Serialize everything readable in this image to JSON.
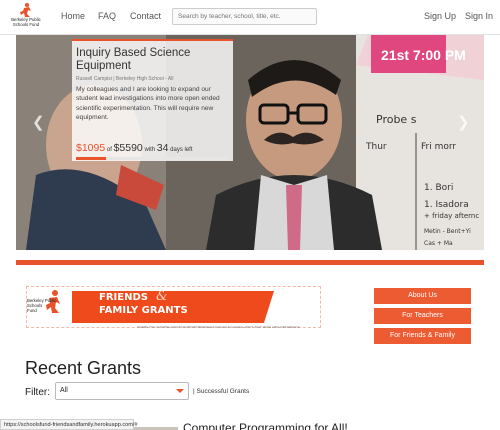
{
  "brand": {
    "line1": "Berkeley Public",
    "line2": "Schools Fund"
  },
  "nav": {
    "home": "Home",
    "faq": "FAQ",
    "contact": "Contact",
    "search_placeholder": "Search by teacher, school, title, etc.",
    "signup": "Sign Up",
    "signin": "Sign In"
  },
  "hero": {
    "title": "Inquiry Based Science Equipment",
    "school": "Russell Campisi | Berkeley High School - All",
    "description": "My colleagues and I are looking to expand our student lead investigations into more open ended scientific experimentation. This will require new equipment.",
    "raised": "$1095",
    "of": "of",
    "goal": "$5590",
    "with": "with",
    "days": "34",
    "days_left": "days left",
    "progress": 0.196,
    "prev_icon": "chevron-left",
    "next_icon": "chevron-right",
    "photo_text": {
      "poster": "21st 7:00 PM",
      "probes": "Probe s",
      "thur": "Thur",
      "fri": "Fri morr",
      "one": "1. Bori",
      "two": "1. Isadora",
      "three": "+ friday afternc",
      "four": "Metin - Bent+Yi",
      "five": "Cas + Ma"
    }
  },
  "banner": {
    "logo_line1": "Berkeley Public",
    "logo_line2": "Schools",
    "logo_line3": "Fund",
    "title_line1": "FRIENDS",
    "ampersand": "&",
    "title_line2": "FAMILY GRANTS",
    "tagline": "WHERE YOU CHOOSE HOW TO SUPPORT BERKELEY SCHOOLS IN SMALL WAYS THAT MAKE A BIG DIFFERENCE"
  },
  "buttons": {
    "about": "About Us",
    "teachers": "For Teachers",
    "friends": "For Friends & Family"
  },
  "recent": {
    "heading": "Recent Grants",
    "filter_label": "Filter:",
    "filter_value": "All",
    "successful": "| Successful Grants",
    "grant_title": "Computer Programming for All!"
  },
  "status_url": "https://schoolsfund-friendsandfamily.herokuapp.com/#",
  "colors": {
    "accent": "#e8532b",
    "button": "#ed5b33"
  }
}
